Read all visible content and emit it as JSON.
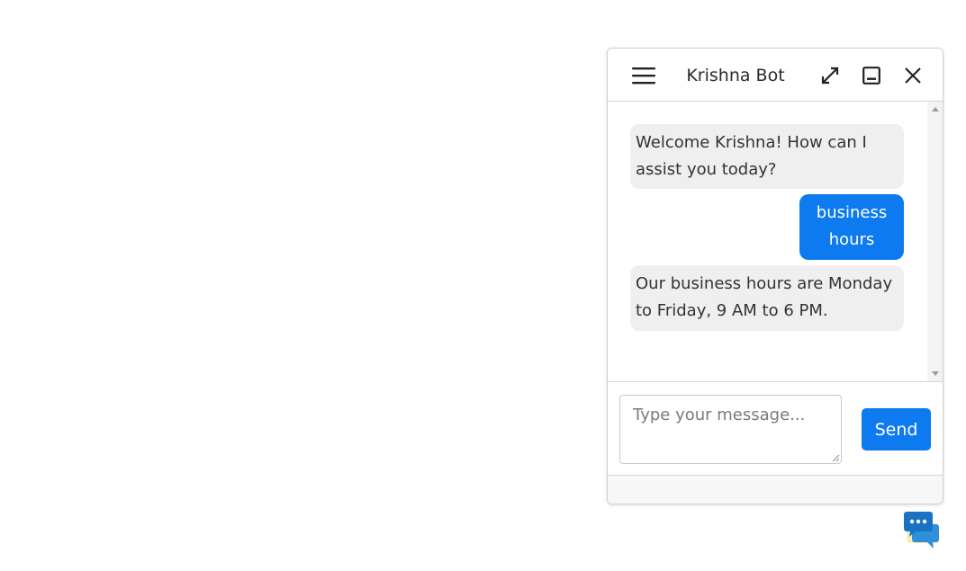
{
  "header": {
    "title": "Krishna Bot",
    "menu_icon": "hamburger-menu-icon",
    "expand_icon": "expand-diagonal-icon",
    "minimize_icon": "minimize-window-icon",
    "close_icon": "close-icon"
  },
  "messages": [
    {
      "sender": "bot",
      "text": "Welcome Krishna! How can I assist you today?"
    },
    {
      "sender": "user",
      "text": "business hours"
    },
    {
      "sender": "bot",
      "text": "Our business hours are Monday to Friday, 9 AM to 6 PM."
    }
  ],
  "composer": {
    "placeholder": "Type your message...",
    "value": "",
    "send_label": "Send"
  },
  "launcher": {
    "icon": "chat-bubbles-icon"
  },
  "colors": {
    "accent": "#0d7af0",
    "bot_bubble": "#efefef",
    "user_text": "#ffffff"
  }
}
